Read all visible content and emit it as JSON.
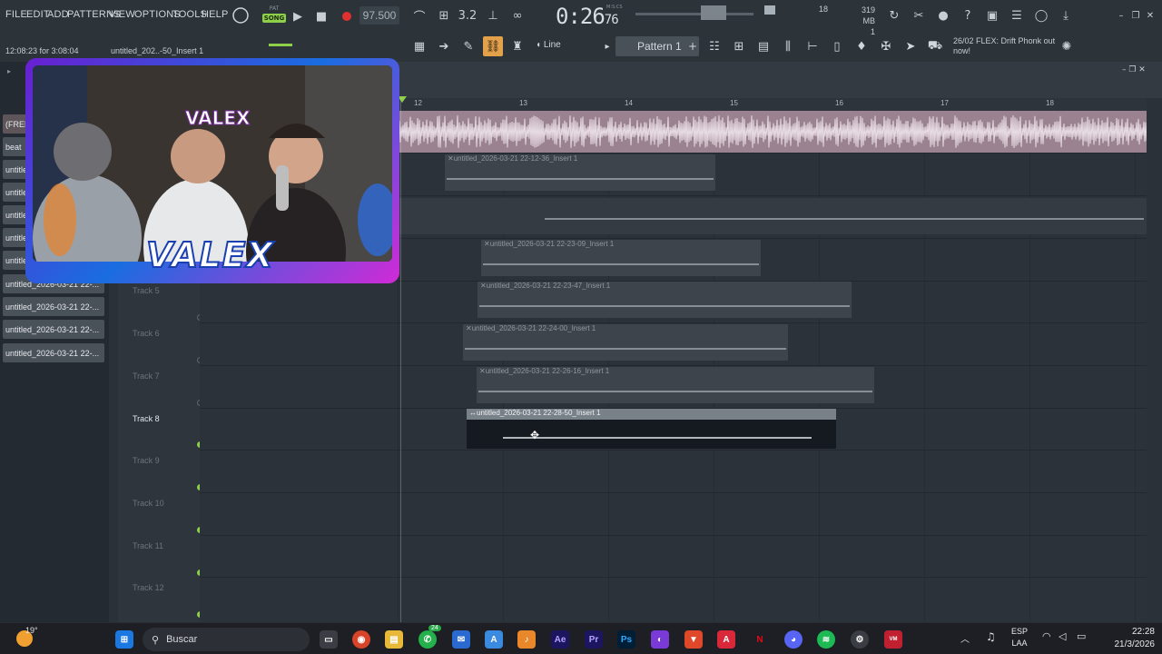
{
  "menu": [
    "FILE",
    "EDIT",
    "ADD",
    "PATTERNS",
    "VIEW",
    "OPTIONS",
    "TOOLS",
    "HELP"
  ],
  "transport": {
    "mode_label_pat": "PAT",
    "mode_label_song": "SONG",
    "tempo": "97.500",
    "time": "0:26",
    "time_ms": "76",
    "time_unit": "M:S:CS"
  },
  "monitor": {
    "cpu": "18",
    "memory": "319 MB",
    "voices": "1"
  },
  "hint": {
    "text": "12:08:23 for 3:08:04",
    "file": "untitled_202..-50_Insert 1"
  },
  "toolbar": {
    "snap": "Line",
    "pattern": "Pattern 1"
  },
  "news": {
    "date": "26/02",
    "text": "FLEX: Drift Phonk out now!"
  },
  "browser": {
    "items": [
      "(FREE F",
      "beat",
      "untitled",
      "untitled",
      "untitled",
      "untitled",
      "untitled",
      "untitled_2026-03-21 22-...",
      "untitled_2026-03-21 22-...",
      "untitled_2026-03-21 22-...",
      "untitled_2026-03-21 22-..."
    ]
  },
  "ruler": {
    "bars": [
      "12",
      "13",
      "14",
      "15",
      "16",
      "17",
      "18"
    ]
  },
  "tracks": [
    {
      "name": "Track 5"
    },
    {
      "name": "Track 6"
    },
    {
      "name": "Track 7"
    },
    {
      "name": "Track 8"
    },
    {
      "name": "Track 9"
    },
    {
      "name": "Track 10"
    },
    {
      "name": "Track 11"
    },
    {
      "name": "Track 12"
    }
  ],
  "clips": [
    "untitled_2026-03-21 22-12-36_Insert 1",
    "untitled_2026-03-21 22-23-09_Insert 1",
    "untitled_2026-03-21 22-23-47_Insert 1",
    "untitled_2026-03-21 22-24-00_Insert 1",
    "untitled_2026-03-21 22-26-16_Insert 1",
    "untitled_2026-03-21 22-28-50_Insert 1"
  ],
  "cam": {
    "brand": "VALEX",
    "brand_top": "VALEX"
  },
  "taskbar": {
    "weather": "19°",
    "search": "Buscar",
    "lang": "ESP",
    "lang2": "LAA",
    "time": "22:28",
    "date": "21/3/2026",
    "badge": "24"
  },
  "colors": {
    "accent_green": "#8ed04a",
    "record": "#e03030",
    "beat_clip": "#9a8291",
    "cam_frame": "#6a1fd1"
  }
}
